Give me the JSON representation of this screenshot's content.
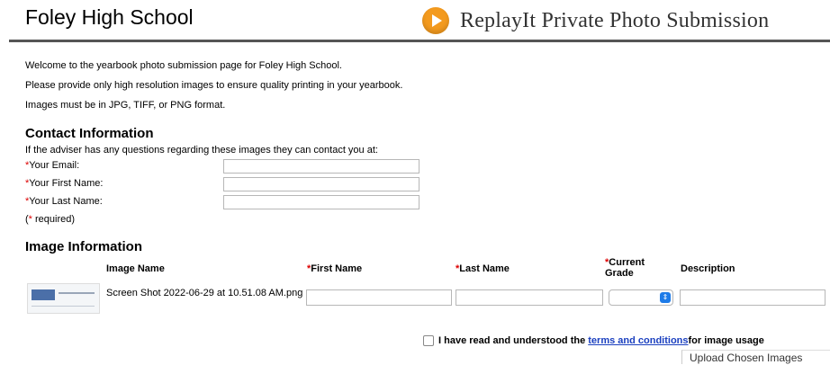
{
  "header": {
    "school_name": "Foley High School",
    "brand_title": "ReplayIt Private Photo Submission"
  },
  "intro": [
    "Welcome to the yearbook photo submission page for Foley High School.",
    "Please provide only high resolution images to ensure quality printing in your yearbook.",
    "Images must be in JPG, TIFF, or PNG format."
  ],
  "contact": {
    "heading": "Contact Information",
    "subtext": "If the adviser has any questions regarding these images they can contact you at:",
    "required_mark": "*",
    "email_label": "Your Email:",
    "first_label": "Your First Name:",
    "last_label": "Your Last Name:",
    "required_note_open": "(",
    "required_note_close": " required)",
    "email_value": "",
    "first_value": "",
    "last_value": ""
  },
  "images": {
    "heading": "Image Information",
    "columns": {
      "image_name": "Image Name",
      "first_name": "First Name",
      "last_name": "Last Name",
      "grade_line1": "Current",
      "grade_line2": "Grade",
      "description": "Description"
    },
    "rows": [
      {
        "file_name": "Screen Shot 2022-06-29 at 10.51.08 AM.png",
        "first_name": "",
        "last_name": "",
        "grade": "",
        "description": ""
      }
    ]
  },
  "terms": {
    "prefix": "I have read and understood the ",
    "link": "terms and conditions",
    "suffix": " for image usage"
  },
  "upload_button": "Upload Chosen Images",
  "colors": {
    "accent_orange": "#f39a1e",
    "required_red": "#dd0000",
    "link_blue": "#1a3fbf",
    "select_blue": "#1e7be8"
  }
}
